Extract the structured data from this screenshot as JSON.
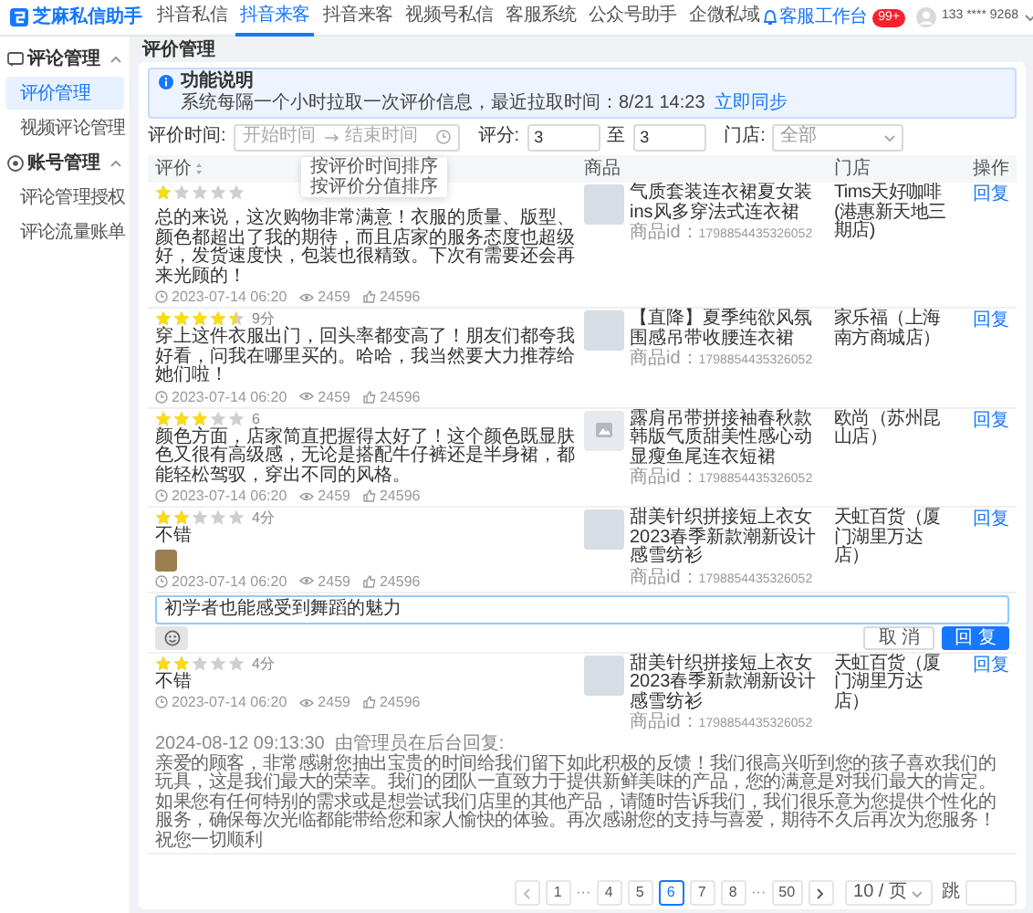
{
  "header": {
    "logo": "芝麻私信助手",
    "nav": [
      {
        "label": "抖音私信",
        "selected": false
      },
      {
        "label": "抖音来客",
        "selected": true
      },
      {
        "label": "抖音来客",
        "selected": false
      },
      {
        "label": "视频号私信",
        "selected": false
      },
      {
        "label": "客服系统",
        "selected": false
      },
      {
        "label": "公众号助手",
        "selected": false
      },
      {
        "label": "企微私域",
        "selected": false
      }
    ],
    "workbench": "客服工作台",
    "badge": "99+",
    "user": "133 **** 9268"
  },
  "sidebar": {
    "groups": [
      {
        "label": "评论管理",
        "kind": "comment",
        "expanded": true,
        "items": [
          {
            "label": "评价管理",
            "selected": true
          },
          {
            "label": "视频评论管理",
            "selected": false
          }
        ]
      },
      {
        "label": "账号管理",
        "kind": "account",
        "expanded": true,
        "items": [
          {
            "label": "评论管理授权",
            "selected": false
          },
          {
            "label": "评论流量账单",
            "selected": false
          }
        ]
      }
    ]
  },
  "page_title": "评价管理",
  "notice": {
    "title": "功能说明",
    "text": "系统每隔一个小时拉取一次评价信息，最近拉取时间：8/21 14:23",
    "link": "立即同步"
  },
  "filters": {
    "time_label": "评价时间:",
    "start_placeholder": "开始时间",
    "end_placeholder": "结束时间",
    "score_label": "评分:",
    "score_min": "3",
    "to": "至",
    "score_max": "3",
    "store_label": "门店:",
    "store_value": "全部"
  },
  "table": {
    "columns": [
      "评价",
      "商品",
      "门店",
      "操作"
    ],
    "sort_menu": [
      "按评价时间排序",
      "按评价分值排序"
    ],
    "rows": [
      {
        "kind": "review",
        "stars": 1,
        "text": "总的来说，这次购物非常满意！衣服的质量、版型、颜色都超出了我的期待，而且店家的服务态度也超级好，发货速度快，包装也很精致。下次有需要还会再来光顾的！",
        "date": "2023-07-14 06:20",
        "views": "2459",
        "likes": "24596",
        "product": {
          "kind": "photo",
          "title": "气质套装连衣裙夏女装ins风多穿法式连衣裙",
          "id": "商品id：1798854435326052"
        },
        "store": "Tims天好咖啡(港惠新天地三期店)",
        "action": "回复"
      },
      {
        "kind": "review",
        "stars": 4.5,
        "score": "9分",
        "text": "穿上这件衣服出门，回头率都变高了！朋友们都夸我好看，问我在哪里买的。哈哈，我当然要大力推荐给她们啦！",
        "date": "2023-07-14 06:20",
        "views": "2459",
        "likes": "24596",
        "product": {
          "kind": "photo",
          "title": "【直降】夏季纯欲风氛围感吊带收腰连衣裙",
          "id": "商品id：1798854435326052"
        },
        "store": "家乐福（上海南方商城店）",
        "action": "回复"
      },
      {
        "kind": "review",
        "stars": 3,
        "score": "6",
        "text": "颜色方面，店家简直把握得太好了！这个颜色既显肤色又很有高级感，无论是搭配牛仔裤还是半身裙，都能轻松驾驭，穿出不同的风格。",
        "date": "2023-07-14 06:20",
        "views": "2459",
        "likes": "24596",
        "product": {
          "kind": "placeholder",
          "title": "露肩吊带拼接袖春秋款韩版气质甜美性感心动显瘦鱼尾连衣短裙",
          "id": "商品id：1798854435326052"
        },
        "store": "欧尚（苏州昆山店）",
        "action": "回复"
      },
      {
        "kind": "review",
        "stars": 2,
        "score": "4分",
        "text": "不错",
        "photo": true,
        "date": "2023-07-14 06:20",
        "views": "2459",
        "likes": "24596",
        "product": {
          "kind": "photo",
          "title": "甜美针织拼接短上衣女2023春季新款潮新设计感雪纺衫",
          "id": "商品id：1798854435326052"
        },
        "store": "天虹百货（厦门湖里万达店）",
        "action": "回复"
      },
      {
        "kind": "reply_editor",
        "value": "初学者也能感受到舞蹈的魅力",
        "cancel": "取 消",
        "submit": "回 复"
      },
      {
        "kind": "review",
        "stars": 2,
        "score": "4分",
        "text": "不错",
        "date": "2023-07-14 06:20",
        "views": "2459",
        "likes": "24596",
        "product": {
          "kind": "photo",
          "title": "甜美针织拼接短上衣女2023春季新款潮新设计感雪纺衫",
          "id": "商品id：1798854435326052"
        },
        "store": "天虹百货（厦门湖里万达店）",
        "action": "回复",
        "reply": {
          "meta": "2024-08-12 09:13:30  由管理员在后台回复:",
          "text": "亲爱的顾客，非常感谢您抽出宝贵的时间给我们留下如此积极的反馈！我们很高兴听到您的孩子喜欢我们的玩具，这是我们最大的荣幸。我们的团队一直致力于提供新鲜美味的产品，您的满意是对我们最大的肯定。如果您有任何特别的需求或是想尝试我们店里的其他产品，请随时告诉我们，我们很乐意为您提供个性化的服务，确保每次光临都能带给您和家人愉快的体验。再次感谢您的支持与喜爱，期待不久后再次为您服务！祝您一切顺利"
        }
      }
    ]
  },
  "pagination": {
    "items": [
      {
        "kind": "prev"
      },
      {
        "kind": "page",
        "label": "1",
        "selected": false
      },
      {
        "kind": "ellipsis",
        "label": "···"
      },
      {
        "kind": "page",
        "label": "4",
        "selected": false
      },
      {
        "kind": "page",
        "label": "5",
        "selected": false
      },
      {
        "kind": "page",
        "label": "6",
        "selected": true
      },
      {
        "kind": "page",
        "label": "7",
        "selected": false
      },
      {
        "kind": "page",
        "label": "8",
        "selected": false
      },
      {
        "kind": "ellipsis",
        "label": "···"
      },
      {
        "kind": "page",
        "label": "50",
        "selected": false
      },
      {
        "kind": "next"
      }
    ],
    "page_size": "10 / 页",
    "jump_label": "跳"
  }
}
